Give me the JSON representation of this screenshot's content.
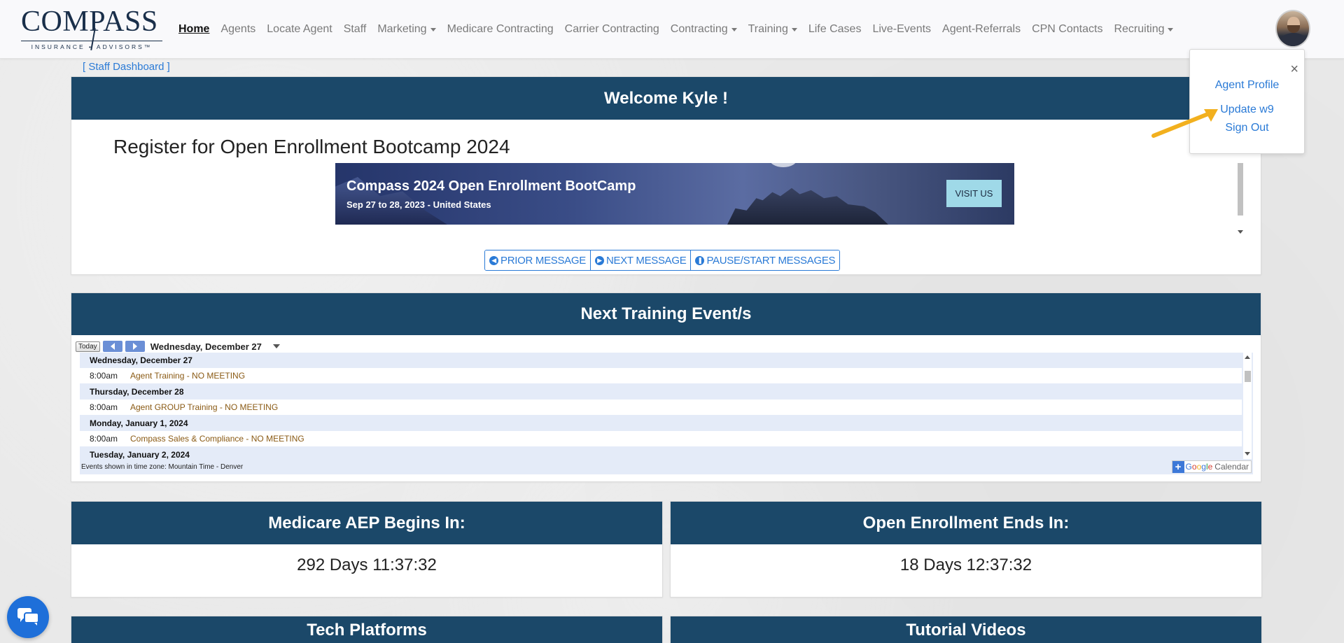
{
  "logo": {
    "main": "COMPASS",
    "sub": "INSURANCE • ADVISORS™"
  },
  "nav": {
    "items": [
      {
        "label": "Home",
        "active": true,
        "dropdown": false
      },
      {
        "label": "Agents",
        "active": false,
        "dropdown": false
      },
      {
        "label": "Locate Agent",
        "active": false,
        "dropdown": false
      },
      {
        "label": "Staff",
        "active": false,
        "dropdown": false
      },
      {
        "label": "Marketing",
        "active": false,
        "dropdown": true
      },
      {
        "label": "Medicare Contracting",
        "active": false,
        "dropdown": false
      },
      {
        "label": "Carrier Contracting",
        "active": false,
        "dropdown": false
      },
      {
        "label": "Contracting",
        "active": false,
        "dropdown": true
      },
      {
        "label": "Training",
        "active": false,
        "dropdown": true
      },
      {
        "label": "Life Cases",
        "active": false,
        "dropdown": false
      },
      {
        "label": "Live-Events",
        "active": false,
        "dropdown": false
      },
      {
        "label": "Agent-Referrals",
        "active": false,
        "dropdown": false
      },
      {
        "label": "CPN Contacts",
        "active": false,
        "dropdown": false
      },
      {
        "label": "Recruiting",
        "active": false,
        "dropdown": true
      }
    ]
  },
  "staff_link": "[ Staff Dashboard ]",
  "welcome": {
    "title": "Welcome Kyle !",
    "message_title": "Register for Open Enrollment Bootcamp 2024",
    "banner": {
      "title": "Compass 2024 Open Enrollment BootCamp",
      "subtitle": "Sep 27 to 28, 2023 - United States",
      "button": "VISIT US"
    },
    "controls": {
      "prior": "PRIOR MESSAGE",
      "next": "NEXT MESSAGE",
      "pause": "PAUSE/START MESSAGES"
    }
  },
  "training": {
    "title": "Next Training Event/s",
    "today_label": "Today",
    "current_date": "Wednesday, December 27",
    "days": [
      {
        "label": "Wednesday, December 27",
        "events": [
          {
            "time": "8:00am",
            "title": "Agent Training - NO MEETING"
          }
        ]
      },
      {
        "label": "Thursday, December 28",
        "events": [
          {
            "time": "8:00am",
            "title": "Agent GROUP Training - NO MEETING"
          }
        ]
      },
      {
        "label": "Monday, January 1, 2024",
        "events": [
          {
            "time": "8:00am",
            "title": "Compass Sales & Compliance - NO MEETING"
          }
        ]
      },
      {
        "label": "Tuesday, January 2, 2024",
        "events": []
      }
    ],
    "timezone_note": "Events shown in time zone: Mountain Time - Denver",
    "gcal": {
      "plus": "+",
      "g1": "G",
      "g2": "o",
      "g3": "o",
      "g4": "g",
      "g5": "l",
      "g6": "e",
      "cal": "Calendar"
    }
  },
  "countdowns": [
    {
      "title": "Medicare AEP Begins In:",
      "value": "292 Days 11:37:32"
    },
    {
      "title": "Open Enrollment Ends In:",
      "value": "18 Days 12:37:32"
    }
  ],
  "bottom_cards": [
    {
      "title": "Tech Platforms"
    },
    {
      "title": "Tutorial Videos"
    }
  ],
  "profile_menu": {
    "close": "×",
    "items": [
      "Agent Profile",
      "Update w9",
      "Sign Out"
    ]
  },
  "colors": {
    "header": "#1b4869",
    "link": "#2a7ad6",
    "arrow": "#f2b01e",
    "chat": "#1e6fd9"
  }
}
